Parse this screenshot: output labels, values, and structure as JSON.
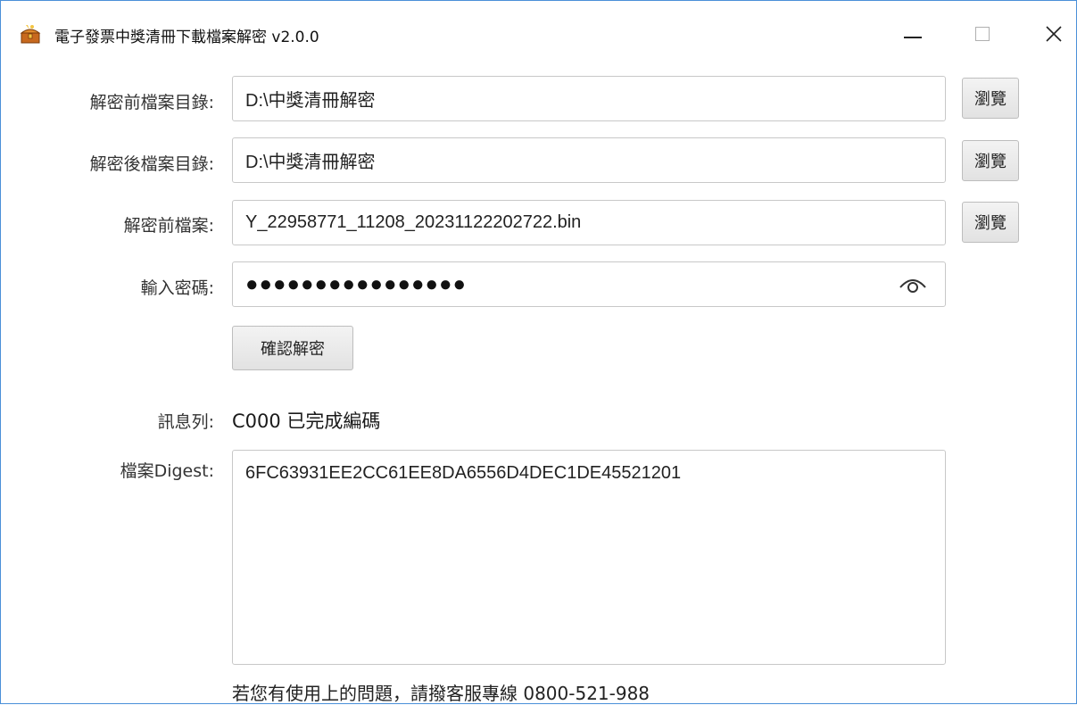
{
  "window": {
    "title": "電子發票中獎清冊下載檔案解密 v2.0.0",
    "icon": "treasure-chest-icon",
    "controls": {
      "minimize": "minimize-icon",
      "maximize": "maximize-icon",
      "close": "close-icon"
    }
  },
  "form": {
    "source_dir": {
      "label": "解密前檔案目錄:",
      "value": "D:\\中獎清冊解密",
      "browse_label": "瀏覽"
    },
    "target_dir": {
      "label": "解密後檔案目錄:",
      "value": "D:\\中獎清冊解密",
      "browse_label": "瀏覽"
    },
    "source_file": {
      "label": "解密前檔案:",
      "value": "Y_22958771_11208_20231122202722.bin",
      "browse_label": "瀏覽"
    },
    "password": {
      "label": "輸入密碼:",
      "masked_value": "●●●●●●●●●●●●●●●●",
      "toggle_icon": "eye-icon"
    },
    "confirm_label": "確認解密"
  },
  "status": {
    "label": "訊息列:",
    "value": "C000 已完成編碼"
  },
  "digest": {
    "label": "檔案Digest:",
    "value": "6FC63931EE2CC61EE8DA6556D4DEC1DE45521201"
  },
  "footer": {
    "help_text": "若您有使用上的問題，請撥客服專線 0800-521-988"
  }
}
